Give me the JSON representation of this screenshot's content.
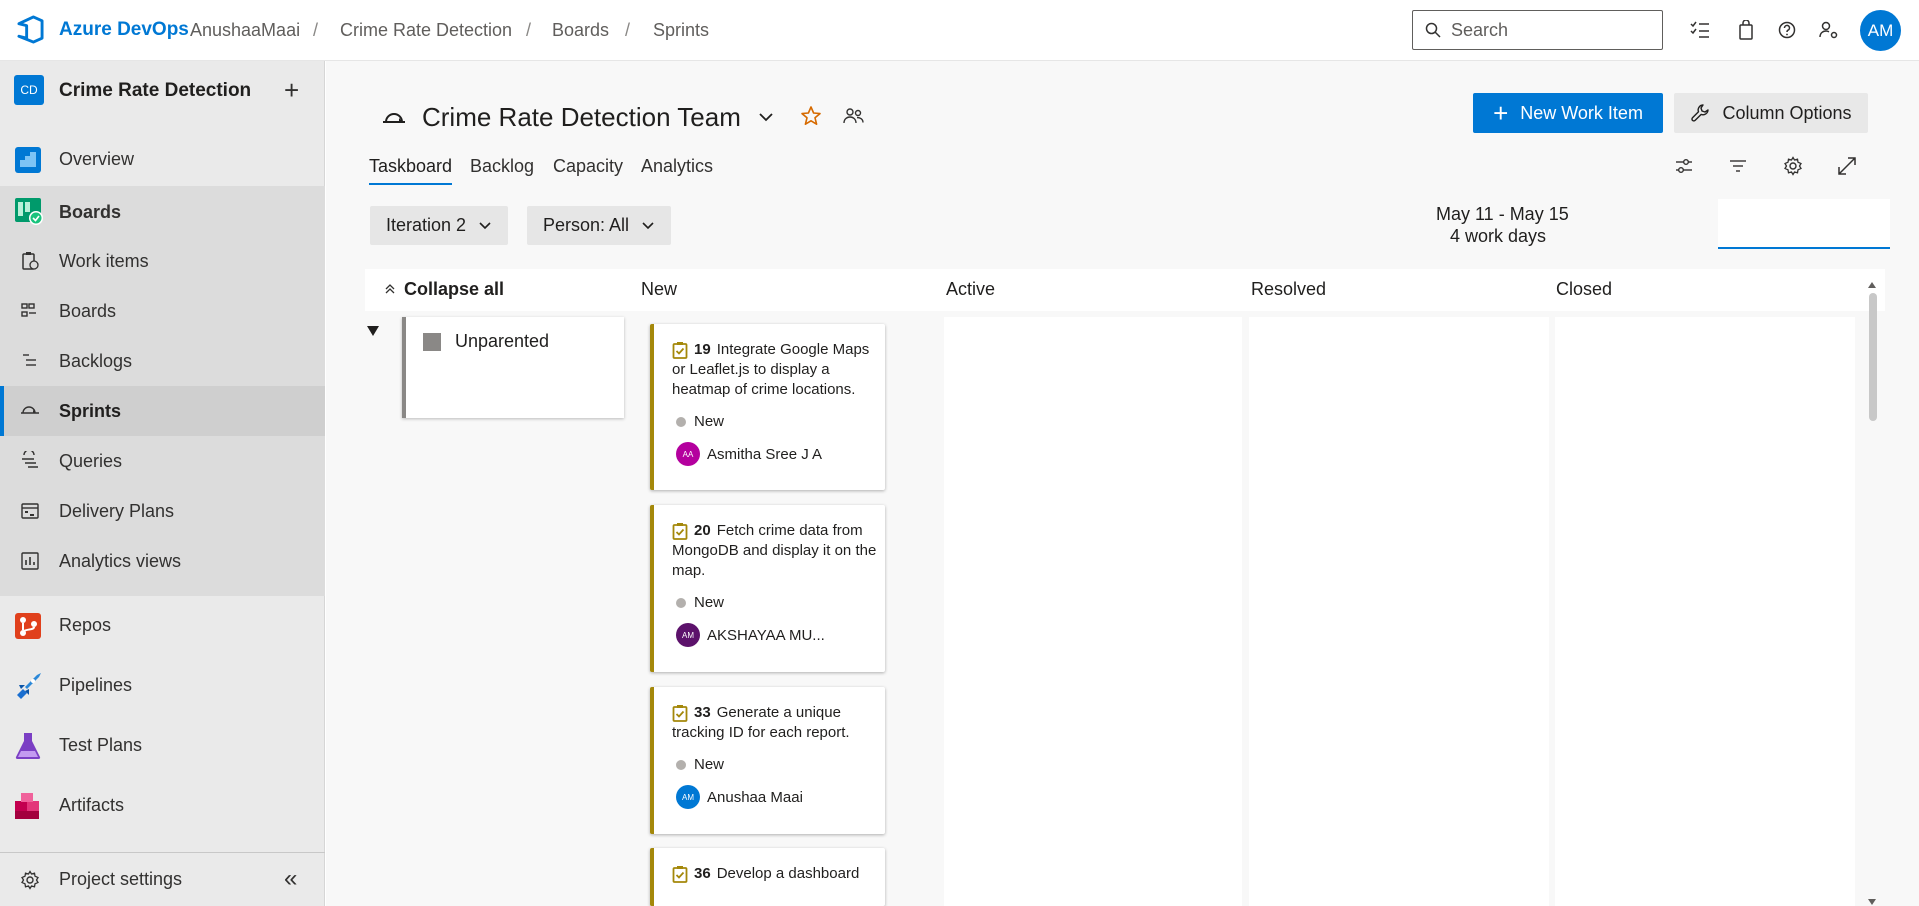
{
  "header": {
    "brand": "Azure DevOps",
    "breadcrumbs": [
      "AnushaaMaai",
      "Crime Rate Detection",
      "Boards",
      "Sprints"
    ],
    "search_placeholder": "Search",
    "avatar_initials": "AM"
  },
  "sidebar": {
    "project_badge": "CD",
    "project_name": "Crime Rate Detection",
    "items": {
      "overview": "Overview",
      "boards": "Boards",
      "work_items": "Work items",
      "boards_sub": "Boards",
      "backlogs": "Backlogs",
      "sprints": "Sprints",
      "queries": "Queries",
      "delivery_plans": "Delivery Plans",
      "analytics_views": "Analytics views",
      "repos": "Repos",
      "pipelines": "Pipelines",
      "test_plans": "Test Plans",
      "artifacts": "Artifacts",
      "project_settings": "Project settings"
    }
  },
  "main": {
    "team_name": "Crime Rate Detection Team",
    "new_work_item": "New Work Item",
    "column_options": "Column Options",
    "tabs": [
      "Taskboard",
      "Backlog",
      "Capacity",
      "Analytics"
    ],
    "iteration": "Iteration 2",
    "person_filter": "Person: All",
    "date_range": "May 11 - May 15",
    "work_days": "4 work days"
  },
  "board": {
    "collapse_all": "Collapse all",
    "columns": [
      "New",
      "Active",
      "Resolved",
      "Closed"
    ],
    "parent_label": "Unparented",
    "cards": [
      {
        "id": "19",
        "title": "Integrate Google Maps or Leaflet.js to display a heatmap of crime locations.",
        "state": "New",
        "assignee": "Asmitha Sree J A",
        "initials": "AA",
        "color": "#b4009e"
      },
      {
        "id": "20",
        "title": "Fetch crime data from MongoDB and display it on the map.",
        "state": "New",
        "assignee": "AKSHAYAA MU...",
        "initials": "AM",
        "color": "#5c126b"
      },
      {
        "id": "33",
        "title": "Generate a unique tracking ID for each report.",
        "state": "New",
        "assignee": "Anushaa Maai",
        "initials": "AM",
        "color": "#0078d4"
      },
      {
        "id": "36",
        "title": "Develop a dashboard",
        "state": "",
        "assignee": "",
        "initials": "",
        "color": ""
      }
    ]
  },
  "colors": {
    "accent": "#0078d4",
    "task": "#a4880a"
  }
}
